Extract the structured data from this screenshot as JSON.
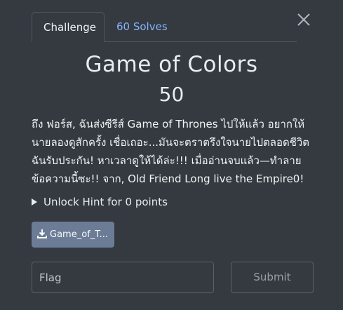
{
  "tabs": {
    "challenge": "Challenge",
    "solves": "60 Solves"
  },
  "challenge": {
    "title": "Game of Colors",
    "points": "50",
    "description": "ถึง ฟอร์ส, ฉันส่งซีรีส์ Game of Thrones ไปให้แล้ว อยากให้นายลองดูสักครั้ง เชื่อเถอะ...มันจะตราตรึงใจนายไปตลอดชีวิต ฉันรับประกัน! หาเวลาดูให้ได้ล่ะ!!! เมื่ออ่านจบแล้ว—ทำลายข้อความนี้ซะ!! จาก, Old Friend Long live the Empire0!",
    "hint_label": "Unlock Hint for 0 points",
    "file_label": "Game_of_T...",
    "flag_placeholder": "Flag",
    "submit_label": "Submit"
  },
  "icons": {
    "close": "close-icon",
    "download": "download-icon",
    "disclosure": "triangle-right-icon"
  },
  "colors": {
    "background": "#343a40",
    "link": "#86b2ff",
    "file_button": "#6c7c96"
  }
}
